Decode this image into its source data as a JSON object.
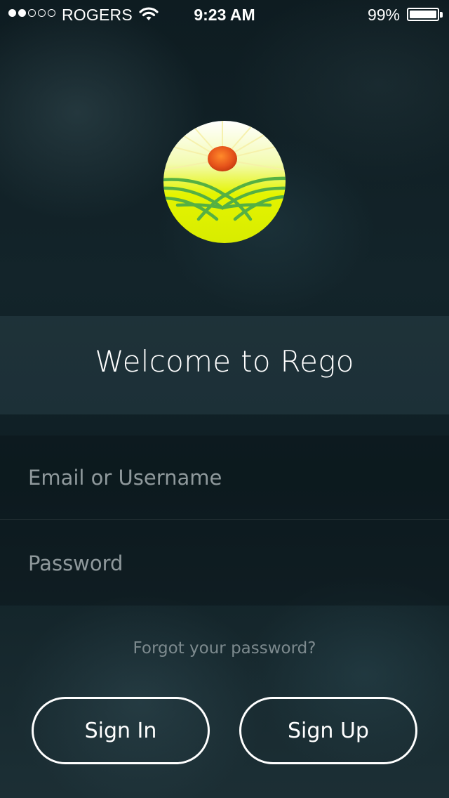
{
  "status_bar": {
    "carrier": "ROGERS",
    "time": "9:23 AM",
    "battery_percent": "99%",
    "battery_level": 0.99,
    "signal_bars_filled": 2,
    "signal_bars_total": 5,
    "wifi_icon": "wifi-icon"
  },
  "logo": {
    "icon": "sun-over-fields-logo",
    "colors": {
      "sun": "#e8531a",
      "field": "#e4f400",
      "stripes": "#55b043"
    }
  },
  "welcome": {
    "title": "Welcome to Rego"
  },
  "form": {
    "email_placeholder": "Email or Username",
    "email_value": "",
    "password_placeholder": "Password",
    "password_value": "",
    "forgot_link": "Forgot your password?"
  },
  "buttons": {
    "sign_in": "Sign In",
    "sign_up": "Sign Up"
  },
  "colors": {
    "background": "#13242a",
    "placeholder_text": "#8f999c",
    "link_text": "#7d8a8e"
  }
}
